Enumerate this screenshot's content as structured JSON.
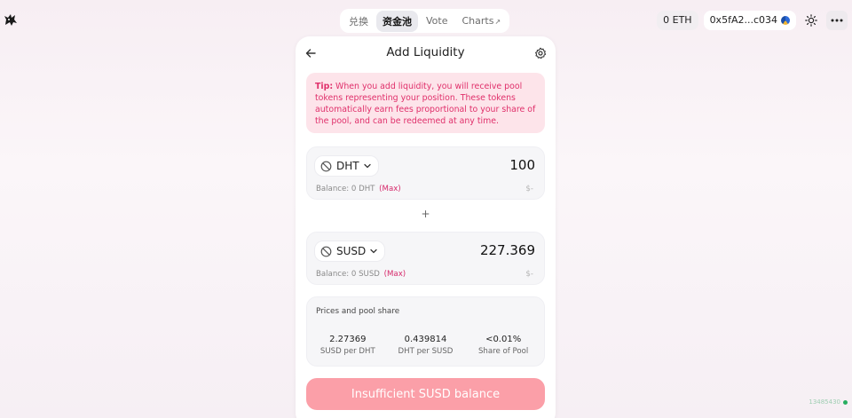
{
  "logo": {
    "icon": "unicorn-logo-icon"
  },
  "nav": {
    "tabs": [
      {
        "label": "兑换"
      },
      {
        "label": "资金池"
      },
      {
        "label": "Vote"
      },
      {
        "label": "Charts",
        "suffix": "↗"
      }
    ],
    "active_index": 1
  },
  "header_right": {
    "eth_balance": "0 ETH",
    "account": "0x5fA2...c034",
    "theme_icon": "sun-icon",
    "more_icon": "more-icon"
  },
  "card": {
    "title": "Add Liquidity",
    "back_icon": "arrow-left-icon",
    "settings_icon": "gear-icon",
    "tip": {
      "prefix": "Tip:",
      "text": " When you add liquidity, you will receive pool tokens representing your position. These tokens automatically earn fees proportional to your share of the pool, and can be redeemed at any time."
    },
    "input_a": {
      "token": "DHT",
      "amount": "100",
      "balance_label": "Balance: 0 DHT",
      "max_label": "(Max)",
      "usd": "$-"
    },
    "plus": "+",
    "input_b": {
      "token": "SUSD",
      "amount": "227.369",
      "balance_label": "Balance: 0 SUSD",
      "max_label": "(Max)",
      "usd": "$-"
    },
    "prices": {
      "title": "Prices and pool share",
      "items": [
        {
          "value": "2.27369",
          "label": "SUSD per DHT"
        },
        {
          "value": "0.439814",
          "label": "DHT per SUSD"
        },
        {
          "value": "<0.01%",
          "label": "Share of Pool"
        }
      ]
    },
    "cta": "Insufficient SUSD balance"
  },
  "status": {
    "text": "13485430"
  },
  "colors": {
    "accent_pink": "#e0306b",
    "cta_bg": "#fb9fa8",
    "tip_bg": "#fde4ea"
  }
}
